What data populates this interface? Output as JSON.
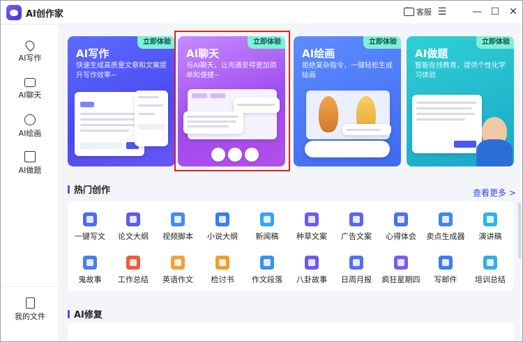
{
  "window": {
    "title": "AI创作家",
    "service_label": "客服",
    "menu_glyph": "☰",
    "min_glyph": "—",
    "max_glyph": "☐",
    "close_glyph": "✕"
  },
  "sidebar": {
    "items": [
      {
        "label": "AI写作",
        "icon": "pen-icon"
      },
      {
        "label": "AI聊天",
        "icon": "chat-icon"
      },
      {
        "label": "AI绘画",
        "icon": "palette-icon"
      },
      {
        "label": "AI做题",
        "icon": "bookmark-icon"
      }
    ],
    "files_label": "我的文件"
  },
  "cards": [
    {
      "title": "AI写作",
      "desc": "快速生成高质量文章和文案提升写作效率~",
      "badge": "立即体验"
    },
    {
      "title": "AI聊天",
      "desc": "与AI聊天，让沟通变得更加简单和便捷~",
      "badge": "立即体验"
    },
    {
      "title": "AI绘画",
      "desc": "拒绝复杂指令，一键轻松生成绘画",
      "badge": "立即体验"
    },
    {
      "title": "AI做题",
      "desc": "智能在线教育，提供个性化学习体验",
      "badge": "立即体验"
    }
  ],
  "hot": {
    "title": "热门创作",
    "more": "查看更多 >",
    "tools": [
      {
        "label": "一键写文",
        "color": "#4a6cf7"
      },
      {
        "label": "论文大纲",
        "color": "#5b5cf0"
      },
      {
        "label": "视频脚本",
        "color": "#3f8df5"
      },
      {
        "label": "小说大纲",
        "color": "#3a7bf6"
      },
      {
        "label": "新闻稿",
        "color": "#3aa3f5"
      },
      {
        "label": "种草文案",
        "color": "#6d5cf2"
      },
      {
        "label": "广告文案",
        "color": "#5867f3"
      },
      {
        "label": "心得体会",
        "color": "#4d70f0"
      },
      {
        "label": "卖点生成器",
        "color": "#3d86f2"
      },
      {
        "label": "演讲稿",
        "color": "#2fb4e8"
      },
      {
        "label": "鬼故事",
        "color": "#4a7cf2"
      },
      {
        "label": "工作总结",
        "color": "#f05a3a"
      },
      {
        "label": "英语作文",
        "color": "#f2a23a"
      },
      {
        "label": "检讨书",
        "color": "#f59b2a"
      },
      {
        "label": "作文段落",
        "color": "#3b8ef3"
      },
      {
        "label": "八卦故事",
        "color": "#6a5bf0"
      },
      {
        "label": "日周月报",
        "color": "#5470f2"
      },
      {
        "label": "疯狂星期四",
        "color": "#7a5cf0"
      },
      {
        "label": "写邮件",
        "color": "#3b7cf4"
      },
      {
        "label": "培训总结",
        "color": "#2fb0e6"
      }
    ]
  },
  "repair": {
    "title": "AI修复"
  }
}
